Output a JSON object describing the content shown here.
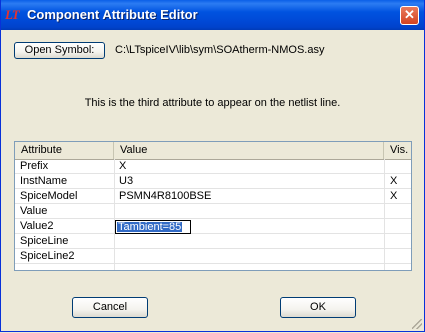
{
  "window": {
    "title": "Component Attribute Editor",
    "logo": "LT",
    "close": "✕"
  },
  "toolbar": {
    "open_symbol_label": "Open Symbol:",
    "path": "C:\\LTspiceIV\\lib\\sym\\SOAtherm-NMOS.asy"
  },
  "description": "This is the third attribute to appear on the netlist line.",
  "table": {
    "columns": [
      "Attribute",
      "Value",
      "Vis."
    ],
    "rows": [
      {
        "attribute": "Prefix",
        "value": "X",
        "vis": ""
      },
      {
        "attribute": "InstName",
        "value": "U3",
        "vis": "X"
      },
      {
        "attribute": "SpiceModel",
        "value": "PSMN4R8100BSE",
        "vis": "X"
      },
      {
        "attribute": "Value",
        "value": "",
        "vis": ""
      },
      {
        "attribute": "Value2",
        "value": "Tambient=85",
        "vis": ""
      },
      {
        "attribute": "SpiceLine",
        "value": "",
        "vis": ""
      },
      {
        "attribute": "SpiceLine2",
        "value": "",
        "vis": ""
      }
    ]
  },
  "buttons": {
    "cancel": "Cancel",
    "ok": "OK"
  }
}
